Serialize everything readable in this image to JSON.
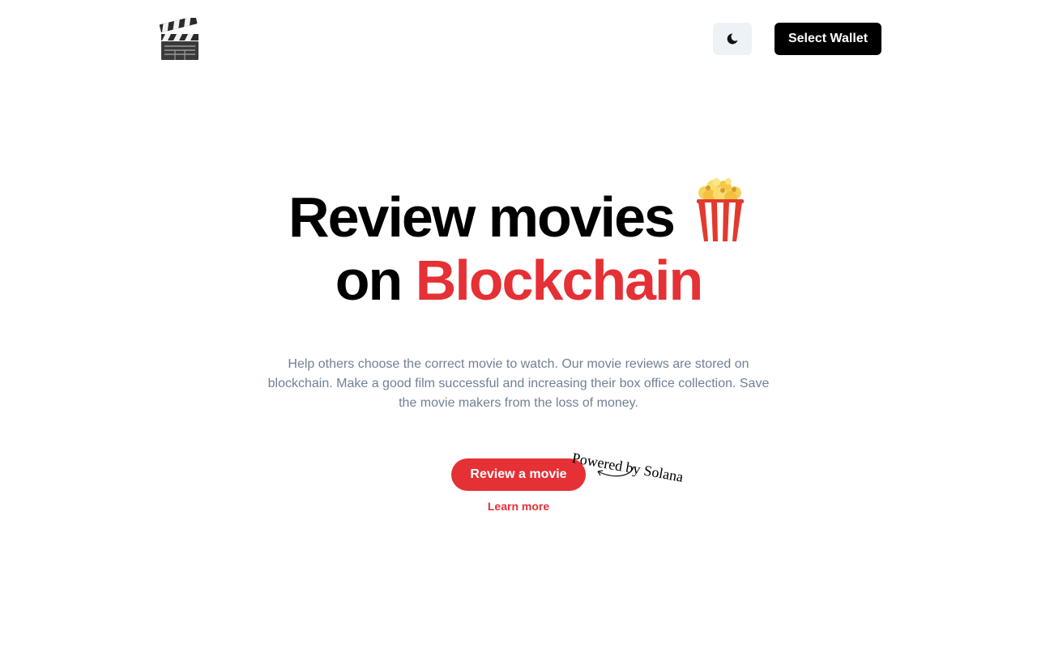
{
  "header": {
    "logo_icon": "clapperboard-icon",
    "theme_toggle_icon": "moon-icon",
    "wallet_button_label": "Select Wallet"
  },
  "hero": {
    "title_line1": "Review movies",
    "title_line2_prefix": "on",
    "title_line2_accent": "Blockchain",
    "title_icon": "popcorn-icon",
    "description": "Help others choose the correct movie to watch. Our movie reviews are stored on blockchain. Make a good film successful and increasing their box office collection. Save the movie makers from the loss of money.",
    "cta_label": "Review a movie",
    "learn_more_label": "Learn more",
    "powered_by": "Powered by Solana"
  },
  "colors": {
    "accent": "#e53035",
    "muted_text": "#718096",
    "toggle_bg": "#edf2f7",
    "wallet_bg": "#000000"
  }
}
